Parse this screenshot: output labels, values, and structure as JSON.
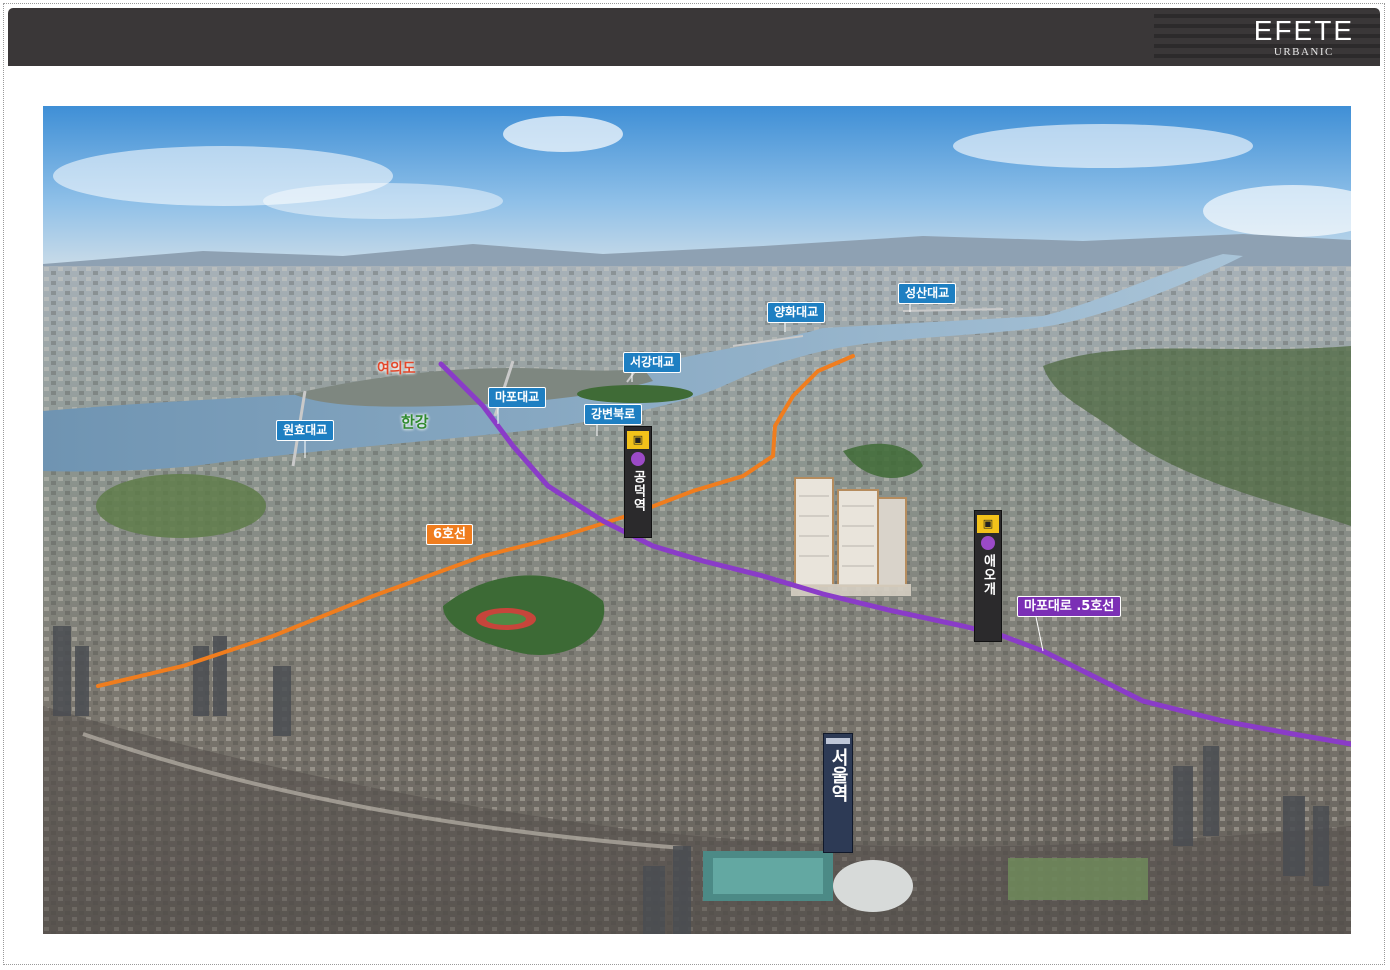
{
  "header": {
    "logo_main": "EFETE",
    "logo_sub": "URBANIC"
  },
  "map": {
    "river_label": "한강",
    "district_label": "여의도",
    "bridges": {
      "wonhyo": "원효대교",
      "mapo": "마포대교",
      "seogang": "서강대교",
      "yanghwa": "양화대교",
      "seongsan": "성산대교"
    },
    "road_label": "강변북로",
    "lines": {
      "line6": "6호선",
      "line5": "마포대로 .5호선"
    },
    "stations": {
      "gongdeok_name": "공덕역",
      "aeogae_name": "애오개",
      "seoul_name": "서울역"
    },
    "colors": {
      "line6": "#f07d1e",
      "line5": "#8a3cc8",
      "label_blue": "#1e7fc2",
      "river": "#7d9fb9"
    }
  }
}
